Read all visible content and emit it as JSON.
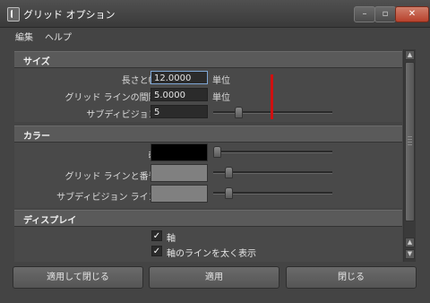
{
  "window": {
    "title": "グリッド オプション",
    "minimize_glyph": "–",
    "maximize_glyph": "▫",
    "close_glyph": "✕"
  },
  "menu": [
    "編集",
    "ヘルプ"
  ],
  "sections": {
    "size": {
      "title": "サイズ",
      "length_width": {
        "label": "長さと幅:",
        "value": "12.0000",
        "unit": "単位"
      },
      "grid_spacing": {
        "label": "グリッド ラインの間隔:",
        "value": "5.0000",
        "unit": "単位"
      },
      "subdivisions": {
        "label": "サブディビジョン:",
        "value": "5"
      }
    },
    "color": {
      "title": "カラー",
      "axis": {
        "label": "軸:",
        "color": "#000000"
      },
      "grid_lines": {
        "label": "グリッド ラインと番号:",
        "color": "#808080"
      },
      "subdivision_lines": {
        "label": "サブディビジョン ライン:",
        "color": "#808080"
      }
    },
    "display": {
      "title": "ディスプレイ",
      "axes": {
        "label": "軸",
        "checked": true
      },
      "thick_axes": {
        "label": "軸のラインを太く表示",
        "checked": true
      }
    }
  },
  "buttons": {
    "apply_close": "適用して閉じる",
    "apply": "適用",
    "close": "閉じる"
  },
  "scroll_arrows": {
    "up": "▲",
    "down": "▼",
    "down2": "▼"
  },
  "check_glyph": "✓"
}
